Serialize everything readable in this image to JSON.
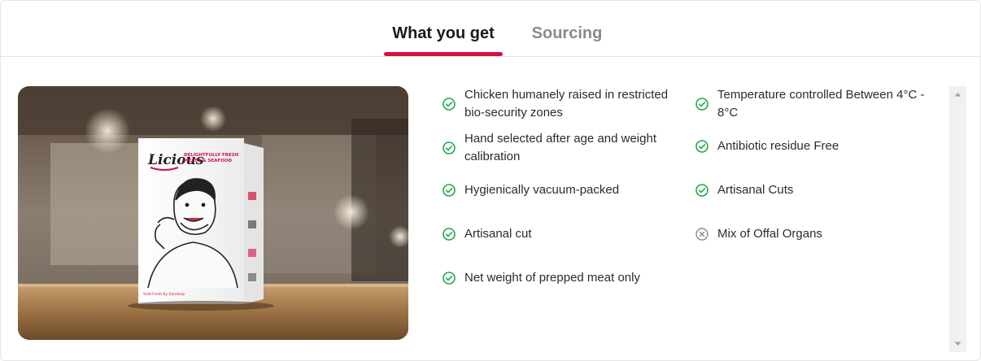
{
  "tabs": [
    {
      "label": "What you get",
      "active": true
    },
    {
      "label": "Sourcing",
      "active": false
    }
  ],
  "accent_color": "#d11243",
  "product_image": {
    "brand": "Licious",
    "tagline": "DELIGHTFULLY FRESH MEATS & SEAFOOD"
  },
  "features": {
    "left": [
      {
        "text": "Chicken humanely raised in restricted bio-security zones",
        "status": "included",
        "icon": "check-circle-icon"
      },
      {
        "text": "Hand selected after age and weight calibration",
        "status": "included",
        "icon": "check-circle-icon"
      },
      {
        "text": "Hygienically vacuum-packed",
        "status": "included",
        "icon": "check-circle-icon"
      },
      {
        "text": "Artisanal cut",
        "status": "included",
        "icon": "check-circle-icon"
      },
      {
        "text": "Net weight of prepped meat only",
        "status": "included",
        "icon": "check-circle-icon"
      }
    ],
    "right": [
      {
        "text": "Temperature controlled Between 4°C - 8°C",
        "status": "included",
        "icon": "check-circle-icon"
      },
      {
        "text": "Antibiotic residue Free",
        "status": "included",
        "icon": "check-circle-icon"
      },
      {
        "text": "Artisanal Cuts",
        "status": "included",
        "icon": "check-circle-icon"
      },
      {
        "text": "Mix of Offal Organs",
        "status": "excluded",
        "icon": "cross-circle-icon"
      }
    ]
  }
}
